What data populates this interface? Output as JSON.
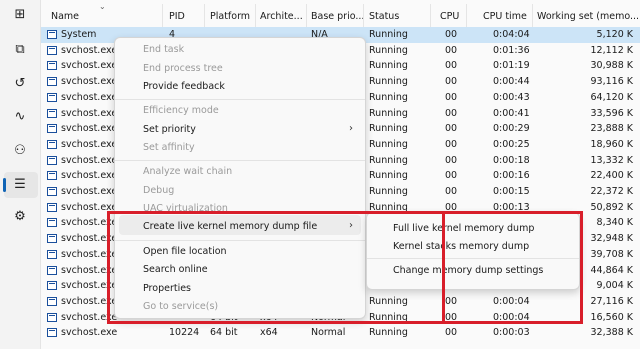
{
  "columns": [
    "Name",
    "PID",
    "Platform",
    "Archite...",
    "Base prio...",
    "Status",
    "CPU",
    "CPU time",
    "Working set (memo..."
  ],
  "rows": [
    {
      "name": "System",
      "pid": "4",
      "platform": "",
      "arch": "",
      "prio": "N/A",
      "status": "Running",
      "cpu": "00",
      "cputime": "0:04:04",
      "ws": "5,120 K"
    },
    {
      "name": "svchost.exe",
      "pid": "",
      "platform": "",
      "arch": "",
      "prio": "",
      "status": "Running",
      "cpu": "00",
      "cputime": "0:01:36",
      "ws": "12,112 K"
    },
    {
      "name": "svchost.exe",
      "pid": "",
      "platform": "",
      "arch": "",
      "prio": "",
      "status": "Running",
      "cpu": "00",
      "cputime": "0:01:19",
      "ws": "30,988 K"
    },
    {
      "name": "svchost.exe",
      "pid": "",
      "platform": "",
      "arch": "",
      "prio": "",
      "status": "Running",
      "cpu": "00",
      "cputime": "0:00:44",
      "ws": "93,116 K"
    },
    {
      "name": "svchost.exe",
      "pid": "",
      "platform": "",
      "arch": "",
      "prio": "",
      "status": "Running",
      "cpu": "00",
      "cputime": "0:00:43",
      "ws": "64,120 K"
    },
    {
      "name": "svchost.exe",
      "pid": "",
      "platform": "",
      "arch": "",
      "prio": "",
      "status": "Running",
      "cpu": "00",
      "cputime": "0:00:41",
      "ws": "33,596 K"
    },
    {
      "name": "svchost.exe",
      "pid": "",
      "platform": "",
      "arch": "",
      "prio": "",
      "status": "Running",
      "cpu": "00",
      "cputime": "0:00:29",
      "ws": "23,888 K"
    },
    {
      "name": "svchost.exe",
      "pid": "",
      "platform": "",
      "arch": "",
      "prio": "",
      "status": "Running",
      "cpu": "00",
      "cputime": "0:00:25",
      "ws": "18,960 K"
    },
    {
      "name": "svchost.exe",
      "pid": "",
      "platform": "",
      "arch": "",
      "prio": "",
      "status": "Running",
      "cpu": "00",
      "cputime": "0:00:18",
      "ws": "13,332 K"
    },
    {
      "name": "svchost.exe",
      "pid": "",
      "platform": "",
      "arch": "",
      "prio": "",
      "status": "Running",
      "cpu": "00",
      "cputime": "0:00:16",
      "ws": "22,400 K"
    },
    {
      "name": "svchost.exe",
      "pid": "",
      "platform": "",
      "arch": "",
      "prio": "",
      "status": "Running",
      "cpu": "00",
      "cputime": "0:00:15",
      "ws": "22,372 K"
    },
    {
      "name": "svchost.exe",
      "pid": "",
      "platform": "",
      "arch": "",
      "prio": "",
      "status": "Running",
      "cpu": "00",
      "cputime": "0:00:13",
      "ws": "50,892 K"
    },
    {
      "name": "svchost.exe",
      "pid": "",
      "platform": "",
      "arch": "",
      "prio": "",
      "status": "",
      "cpu": "",
      "cputime": "",
      "ws": "8,340 K"
    },
    {
      "name": "svchost.exe",
      "pid": "",
      "platform": "",
      "arch": "",
      "prio": "",
      "status": "",
      "cpu": "",
      "cputime": "",
      "ws": "32,948 K"
    },
    {
      "name": "svchost.exe",
      "pid": "",
      "platform": "",
      "arch": "",
      "prio": "",
      "status": "",
      "cpu": "",
      "cputime": "",
      "ws": "39,708 K"
    },
    {
      "name": "svchost.exe",
      "pid": "",
      "platform": "",
      "arch": "",
      "prio": "",
      "status": "",
      "cpu": "",
      "cputime": "",
      "ws": "44,864 K"
    },
    {
      "name": "svchost.exe",
      "pid": "",
      "platform": "",
      "arch": "",
      "prio": "",
      "status": "Running",
      "cpu": "00",
      "cputime": "0:00:04",
      "ws": "9,004 K"
    },
    {
      "name": "svchost.exe",
      "pid": "",
      "platform": "",
      "arch": "",
      "prio": "",
      "status": "Running",
      "cpu": "00",
      "cputime": "0:00:04",
      "ws": "27,116 K"
    },
    {
      "name": "svchost.exe",
      "pid": "",
      "platform": "64 bit",
      "arch": "x64",
      "prio": "Normal",
      "status": "Running",
      "cpu": "00",
      "cputime": "0:00:04",
      "ws": "16,560 K"
    },
    {
      "name": "svchost.exe",
      "pid": "10224",
      "platform": "64 bit",
      "arch": "x64",
      "prio": "Normal",
      "status": "Running",
      "cpu": "00",
      "cputime": "0:00:03",
      "ws": "32,388 K"
    }
  ],
  "context_menu": {
    "items": [
      {
        "label": "End task",
        "disabled": true
      },
      {
        "label": "End process tree",
        "disabled": true
      },
      {
        "label": "Provide feedback",
        "disabled": false
      },
      {
        "label": "Efficiency mode",
        "disabled": true
      },
      {
        "label": "Set priority",
        "disabled": false,
        "submenu": true
      },
      {
        "label": "Set affinity",
        "disabled": true
      },
      {
        "label": "Analyze wait chain",
        "disabled": true
      },
      {
        "label": "Debug",
        "disabled": true
      },
      {
        "label": "UAC virtualization",
        "disabled": true
      },
      {
        "label": "Create live kernel memory dump file",
        "disabled": false,
        "submenu": true
      },
      {
        "label": "Open file location",
        "disabled": false
      },
      {
        "label": "Search online",
        "disabled": false
      },
      {
        "label": "Properties",
        "disabled": false
      },
      {
        "label": "Go to service(s)",
        "disabled": true
      }
    ]
  },
  "submenu": {
    "items": [
      "Full live kernel memory dump",
      "Kernel stacks memory dump",
      "Change memory dump settings"
    ]
  },
  "colors": {
    "highlight": "#d81e2a",
    "selection": "#cce4f7"
  }
}
